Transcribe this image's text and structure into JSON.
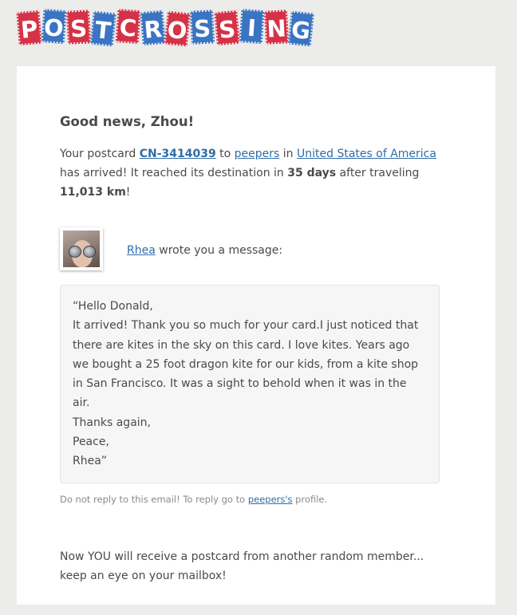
{
  "brand": {
    "letters": [
      "P",
      "O",
      "S",
      "T",
      "C",
      "R",
      "O",
      "S",
      "S",
      "I",
      "N",
      "G"
    ],
    "colors": {
      "red": "#d63247",
      "blue": "#3a74c4"
    }
  },
  "email": {
    "greeting": "Good news, Zhou!",
    "intro_prefix": "Your postcard ",
    "postcard_id": "CN-3414039",
    "to_text": " to ",
    "recipient": "peepers",
    "in_text": " in ",
    "country": "United States of America",
    "arrived_text": " has arrived! It reached its destination in ",
    "days": "35 days",
    "after_text": " after traveling ",
    "distance": "11,013 km",
    "exclaim": "!",
    "sender_name": "Rhea",
    "sender_suffix": " wrote you a message:",
    "message": "“Hello Donald,\nIt arrived! Thank you so much for your card.I just noticed that there are kites in the sky on this card. I love kites. Years ago we bought a 25 foot dragon kite for our kids, from a kite shop in San Francisco. It was a sight to behold when it was in the air.\nThanks again,\nPeace,\nRhea”",
    "note_prefix": "Do not reply to this email! To reply go to ",
    "note_link": "peepers's",
    "note_suffix": " profile.",
    "closing_line1": "Now YOU will receive a postcard from another random member...",
    "closing_line2": "keep an eye on your mailbox!"
  }
}
